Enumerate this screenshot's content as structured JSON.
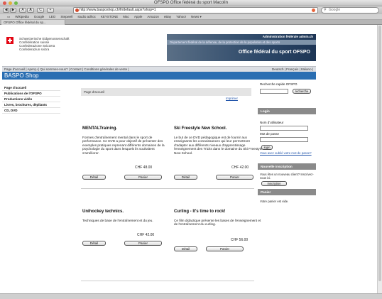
{
  "window": {
    "title": "OFSPO Office fédéral du sport Macolin"
  },
  "toolbar": {
    "back": "◀",
    "forward": "▶",
    "text_small": "A",
    "text_large": "A",
    "reload": "C",
    "add": "+",
    "url": "http://www.basposhop.ch/fr/default.aspx?shop=1",
    "search_placeholder": "Google"
  },
  "bookmarks": [
    "Wikipedia",
    "Google",
    "LEO",
    "Stepwell",
    "studio adhoc",
    "KEYSTONE",
    "Mac",
    "Apple",
    "Amazon",
    "eBay",
    "Yahoo!",
    "News ▾"
  ],
  "tab": {
    "label": "OFSPO Office fédéral du sp..."
  },
  "header": {
    "org_lines": [
      "Schweizerische Eidgenossenschaft",
      "Confédération suisse",
      "Confederazione Svizzera",
      "Confederaziun svizra"
    ],
    "admin_link": "Administration fédérale admin.ch",
    "strip_text": "Département fédéral de la défense, de la protection de la population et des sports",
    "site_title": "Office fédéral du sport OFSPO"
  },
  "nav": {
    "left": "Page d'accueil | Aperçu | Qui sommes-nous? | Contact | Conditions générales de vente |",
    "right": "Deutsch | Français | Italiano |"
  },
  "shop": {
    "title": "BASPO Shop"
  },
  "leftnav": [
    "Page d'accueil",
    "Publications de l'OFSPO",
    "Productions vidéo",
    "Livres, brochures, dépliants",
    "CD, DVD"
  ],
  "breadcrumb": "Page d'accueil",
  "top_link": "Imprimer",
  "products": [
    {
      "name": "MENTALTraining.",
      "desc": "Formes d'entraînement mental dans le sport de performance. Ce DVD a pour objectif de présenter des exemples pratiques reprenant différents domaines de la psychologie du sport dans lesquels ils souhaitent s'améliorer.",
      "price": "CHF 48.00",
      "detail": "Détail",
      "cart": "Panier"
    },
    {
      "name": "Ski Freestyle New School.",
      "desc": "Le but de ce DVD pédagogique est de fournir aux enseignants les connaissances qui leur permettront d'adapter aux différents niveaux d'apprentissage l'enseignement des Tricks dans le domaine du Ski Freestyle New School.",
      "price": "CHF 42.00",
      "detail": "Détail",
      "cart": "Panier"
    },
    {
      "name": "Unihockey technics.",
      "desc": "Techniques de base de l'entraînement et du jeu.",
      "price": "CHF 42.00",
      "detail": "Détail",
      "cart": "Panier"
    },
    {
      "name": "Curling - It's time to rock!",
      "desc": "Ce film didactique présente les bases de l'enseignement et de l'entraînement du curling.",
      "price": "CHF 56.00",
      "detail": "Détail",
      "cart": "Panier"
    }
  ],
  "sidebar": {
    "search_label": "Recherche rapide OFSPO",
    "search_button": "recherche",
    "login_header": "Login",
    "username_label": "Nom d'utilisateur",
    "password_label": "Mot de passe",
    "login_button": "login",
    "forgot_link": "Vous avez oublié votre mot de passe?",
    "register_header": "Nouvelle inscription",
    "register_text": "Vous êtes un nouveau client? Inscrivez-vous ici.",
    "register_button": "Inscription",
    "cart_header": "Panier",
    "cart_text": "Votre panier est vide."
  }
}
